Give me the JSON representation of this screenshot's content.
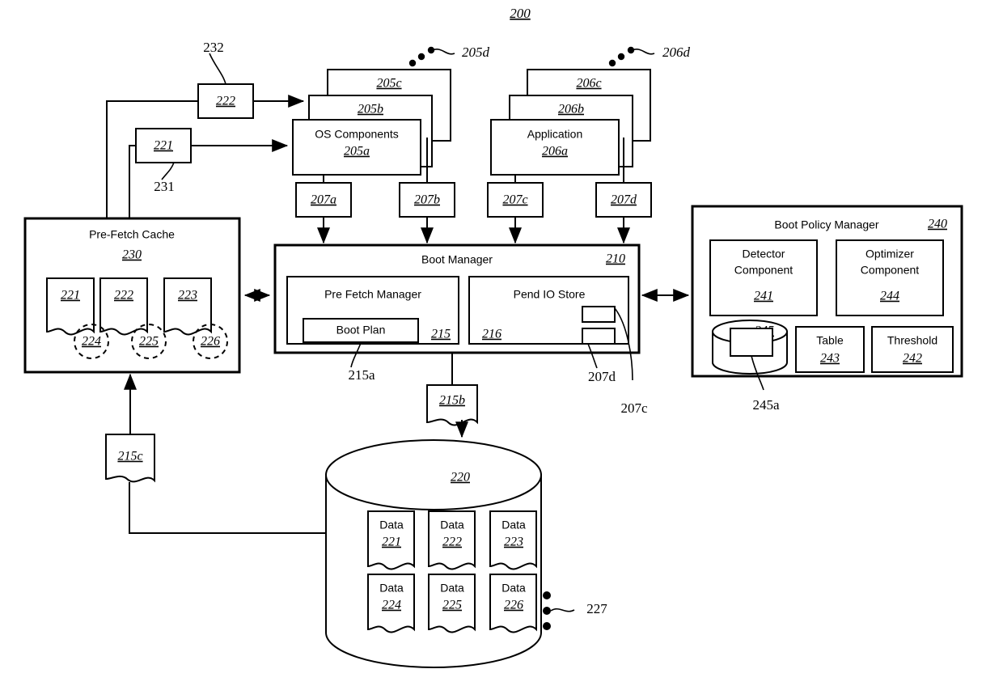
{
  "figure": {
    "number": "200",
    "title_ref": "200"
  },
  "os_stack": {
    "label": "OS Components",
    "front_ref": "205a",
    "layer2_ref": "205b",
    "layer3_ref": "205c",
    "ellipsis_ref": "205d"
  },
  "app_stack": {
    "label": "Application",
    "front_ref": "206a",
    "layer2_ref": "206b",
    "layer3_ref": "206c",
    "ellipsis_ref": "206d"
  },
  "io_requests": [
    {
      "ref": "207a"
    },
    {
      "ref": "207b"
    },
    {
      "ref": "207c"
    },
    {
      "ref": "207d"
    }
  ],
  "cache_feeders": [
    {
      "ref": "222",
      "callout": "232"
    },
    {
      "ref": "221",
      "callout": "231"
    }
  ],
  "pre_fetch_cache": {
    "label": "Pre-Fetch Cache",
    "ref": "230",
    "pages": [
      {
        "ref": "221"
      },
      {
        "ref": "222"
      },
      {
        "ref": "223"
      }
    ],
    "circles": [
      {
        "ref": "224"
      },
      {
        "ref": "225"
      },
      {
        "ref": "226"
      }
    ]
  },
  "boot_manager": {
    "label": "Boot Manager",
    "ref": "210",
    "pre_fetch_manager": {
      "label": "Pre Fetch Manager",
      "ref": "215",
      "boot_plan": {
        "label": "Boot Plan",
        "callout": "215a"
      }
    },
    "pend_io_store": {
      "label": "Pend IO Store",
      "ref": "216",
      "slot_callouts": [
        "207d",
        "207c"
      ]
    },
    "plan_doc_ref": "215b"
  },
  "boot_policy_manager": {
    "label": "Boot Policy Manager",
    "ref": "240",
    "detector": {
      "line1": "Detector",
      "line2": "Component",
      "ref": "241"
    },
    "optimizer": {
      "line1": "Optimizer",
      "line2": "Component",
      "ref": "244"
    },
    "store": {
      "ref": "245",
      "inner_callout": "245a"
    },
    "table": {
      "label": "Table",
      "ref": "243"
    },
    "threshold": {
      "label": "Threshold",
      "ref": "242"
    }
  },
  "storage": {
    "ref": "220",
    "feedback_doc_ref": "215c",
    "more_data_ref": "227",
    "data_items": [
      {
        "label": "Data",
        "ref": "221"
      },
      {
        "label": "Data",
        "ref": "222"
      },
      {
        "label": "Data",
        "ref": "223"
      },
      {
        "label": "Data",
        "ref": "224"
      },
      {
        "label": "Data",
        "ref": "225"
      },
      {
        "label": "Data",
        "ref": "226"
      }
    ]
  },
  "colors": {
    "stroke": "#000000",
    "fill": "#ffffff",
    "background": "#ffffff"
  }
}
